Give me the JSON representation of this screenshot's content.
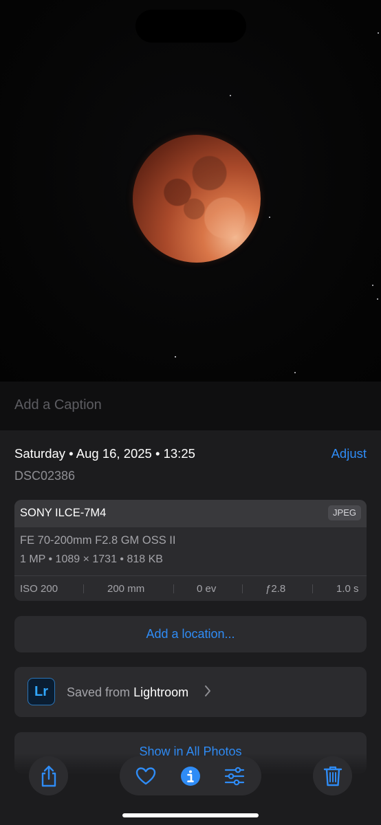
{
  "caption": {
    "placeholder": "Add a Caption"
  },
  "info": {
    "date": "Saturday • Aug 16, 2025 • 13:25",
    "adjust_label": "Adjust",
    "filename": "DSC02386"
  },
  "exif": {
    "camera": "SONY ILCE-7M4",
    "format": "JPEG",
    "lens": "FE 70-200mm F2.8 GM OSS II",
    "specs": "1 MP • 1089 × 1731 • 818 KB",
    "iso": "ISO 200",
    "focal_length": "200 mm",
    "exposure_value": "0 ev",
    "aperture": "ƒ2.8",
    "shutter": "1.0 s"
  },
  "location": {
    "label": "Add a location..."
  },
  "lightroom": {
    "prefix": "Saved from",
    "app": "Lightroom",
    "icon_text": "Lr"
  },
  "show_all": {
    "label": "Show in All Photos"
  },
  "toolbar": {
    "buttons": [
      "share-icon",
      "heart-icon",
      "info-icon",
      "adjust-sliders-icon",
      "trash-icon"
    ],
    "accent": "#2f8cf6"
  }
}
